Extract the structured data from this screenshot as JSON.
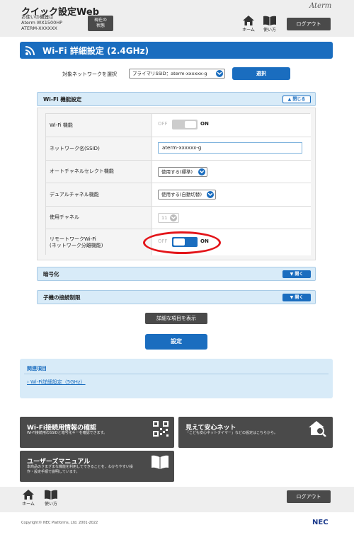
{
  "header": {
    "app_title": "クイック設定Web",
    "device_line1": "お使いの機器は",
    "device_line2": "Aterm WX1500HP",
    "device_line3": "ATERM-XXXXXX",
    "status_button_line1": "現在の",
    "status_button_line2": "状態",
    "brand": "Aterm",
    "home_label": "ホーム",
    "guide_label": "使い方",
    "logout_label": "ログアウト"
  },
  "title": "Wi-Fi 詳細設定 (2.4GHz)",
  "network_select": {
    "label": "対象ネットワークを選択",
    "value": "プライマリSSID：aterm-xxxxxx-g",
    "button": "選択"
  },
  "wifi_function": {
    "section_title": "Wi-Fi 機能設定",
    "toggle_button": "閉じる",
    "rows": {
      "wifi_enable": {
        "label": "Wi-Fi 機能",
        "off": "OFF",
        "on": "ON",
        "state": "off"
      },
      "ssid": {
        "label": "ネットワーク名(SSID)",
        "value": "aterm-xxxxxx-g"
      },
      "auto_channel": {
        "label": "オートチャネルセレクト機能",
        "value": "使用する(標準)"
      },
      "dual_channel": {
        "label": "デュアルチャネル機能",
        "value": "使用する(自動切替)"
      },
      "channel": {
        "label": "使用チャネル",
        "value": "11"
      },
      "remote_work": {
        "label_line1": "リモートワークWi-Fi",
        "label_line2": "(ネットワーク分離機能)",
        "off": "OFF",
        "on": "ON",
        "state": "on"
      }
    }
  },
  "encryption": {
    "section_title": "暗号化",
    "toggle_button": "開く"
  },
  "connection_limit": {
    "section_title": "子機の接続制限",
    "toggle_button": "開く"
  },
  "show_details_button": "詳細な項目を表示",
  "apply_button": "設定",
  "related": {
    "title": "関連項目",
    "link": "Wi-Fi詳細設定（5GHz）"
  },
  "cards": {
    "wifi_info": {
      "title": "Wi-Fi接続用情報の確認",
      "desc": "Wi-Fi接続用のSSIDと暗号化キーを確認できます。"
    },
    "safe_net": {
      "title": "見えて安心ネット",
      "desc": "「こども安心ネットタイマー」などの設定はこちらから。"
    },
    "manual": {
      "title": "ユーザーズマニュアル",
      "desc1": "本商品のさまざまな機能を利用してできることを、わかりやすい操",
      "desc2": "作・設定手順で説明しています。"
    }
  },
  "footer": {
    "home_label": "ホーム",
    "guide_label": "使い方",
    "logout_label": "ログアウト",
    "copyright": "Copyright© NEC Platforms, Ltd. 2001-2022",
    "maker": "NEC"
  },
  "colors": {
    "accent": "#1a6dbf",
    "highlight": "#e3151a",
    "dark_button": "#4a4a4a",
    "section_bg": "#d8ebf8"
  }
}
